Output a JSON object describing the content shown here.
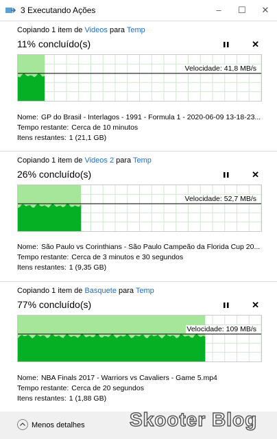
{
  "window": {
    "title": "3 Executando Ações",
    "minimize_icon": "minimize-icon",
    "maximize_icon": "maximize-icon",
    "close_icon": "close-icon"
  },
  "operations": [
    {
      "prefix": "Copiando 1 item de",
      "source": "Videos",
      "joiner": "para",
      "dest": "Temp",
      "percent_text": "11% concluído(s)",
      "progress": 0.11,
      "speed_label": "Velocidade: 41,8 MB/s",
      "name_label": "Nome:",
      "name": "GP do Brasil - Interlagos - 1991 - Formula 1 - 2020-06-09 13-18-23...",
      "time_label": "Tempo restante:",
      "time": "Cerca de 10 minutos",
      "items_label": "Itens restantes:",
      "items": "1 (21,1 GB)"
    },
    {
      "prefix": "Copiando 1 item de",
      "source": "Videos 2",
      "joiner": "para",
      "dest": "Temp",
      "percent_text": "26% concluído(s)",
      "progress": 0.26,
      "speed_label": "Velocidade: 52,7 MB/s",
      "name_label": "Nome:",
      "name": "São Paulo vs Corinthians - São Paulo Campeão da Florida Cup 20...",
      "time_label": "Tempo restante:",
      "time": "Cerca de 3 minutos e 30 segundos",
      "items_label": "Itens restantes:",
      "items": "1 (9,35 GB)"
    },
    {
      "prefix": "Copiando 1 item de",
      "source": "Basquete",
      "joiner": "para",
      "dest": "Temp",
      "percent_text": "77% concluído(s)",
      "progress": 0.77,
      "speed_label": "Velocidade: 109 MB/s",
      "name_label": "Nome:",
      "name": "NBA Finals 2017 - Warriors vs Cavaliers - Game 5.mp4",
      "time_label": "Tempo restante:",
      "time": "Cerca de 20 segundos",
      "items_label": "Itens restantes:",
      "items": "1 (1,88 GB)"
    }
  ],
  "footer": {
    "less_details": "Menos detalhes"
  },
  "watermark": "Skooter Blog",
  "colors": {
    "progress_light": "#a6e69a",
    "progress_dark": "#06b025",
    "link": "#1a6fd1"
  }
}
